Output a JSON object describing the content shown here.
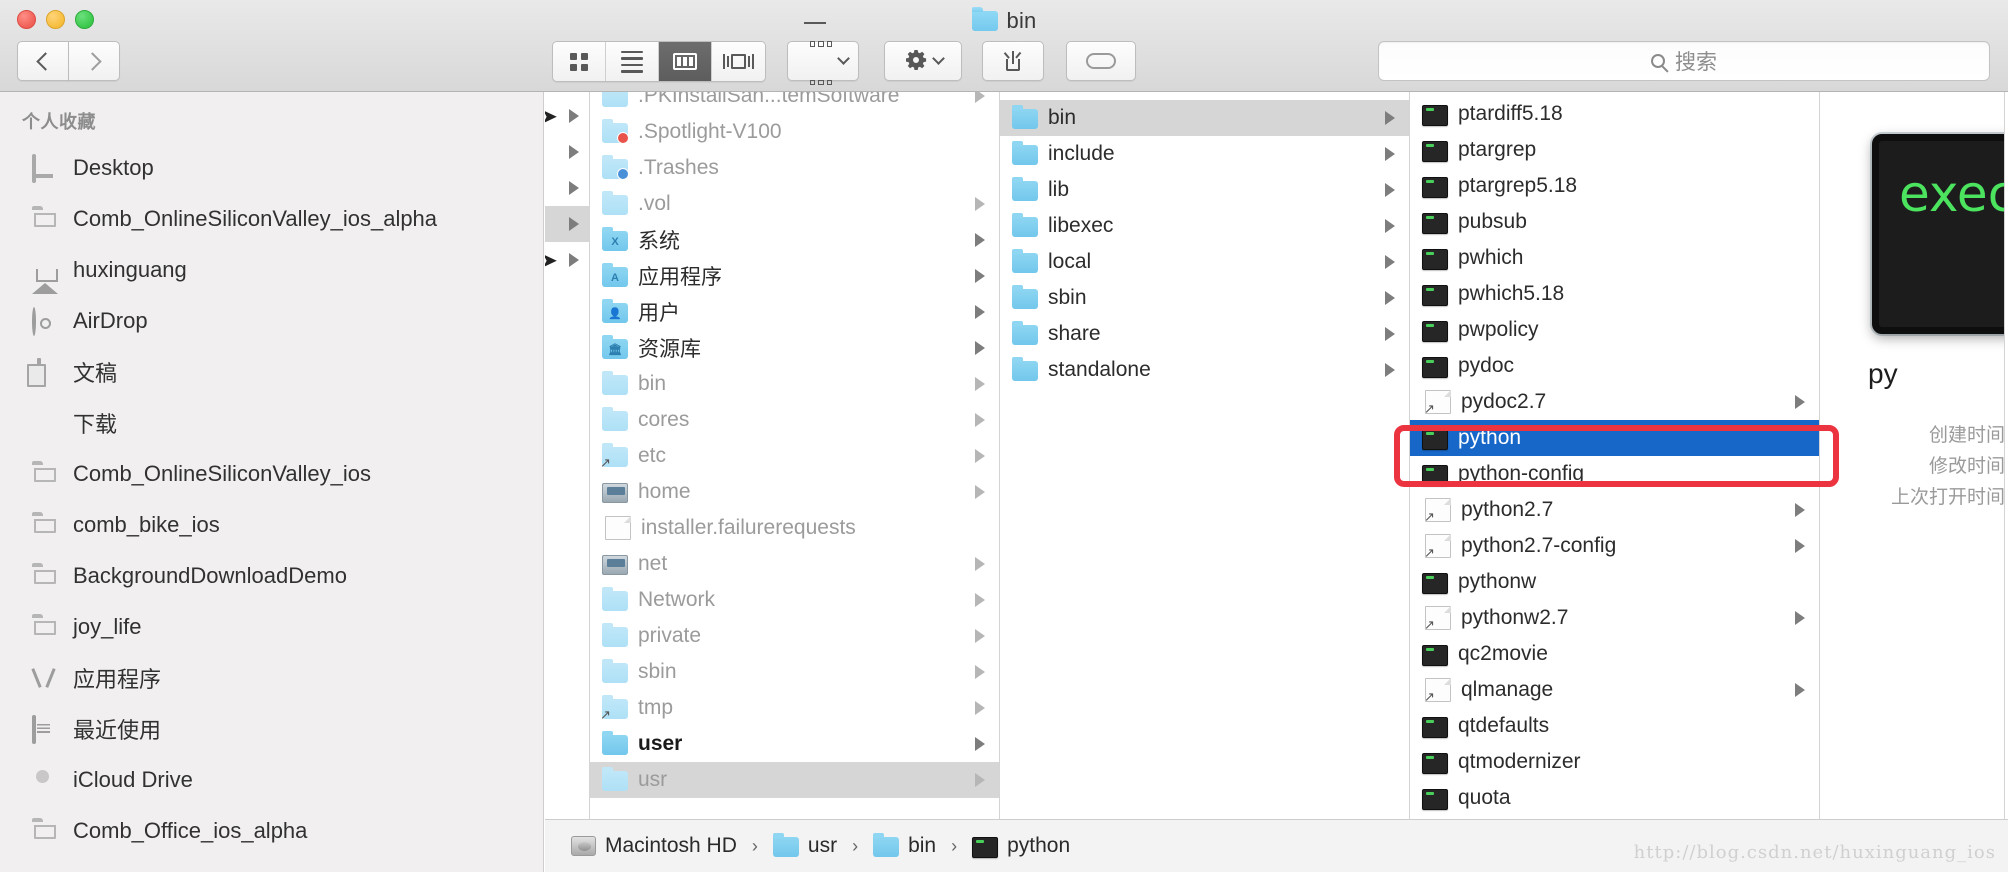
{
  "window": {
    "title": "bin",
    "title_icon": "blue-folder-icon",
    "traffic_lights": [
      "close-red",
      "minimize-yellow",
      "maximize-green"
    ]
  },
  "toolbar": {
    "back_label": "‹",
    "forward_label": "›",
    "view_buttons": [
      {
        "name": "icon-view",
        "active": false
      },
      {
        "name": "list-view",
        "active": false
      },
      {
        "name": "column-view",
        "active": true
      },
      {
        "name": "coverflow-view",
        "active": false
      }
    ],
    "arrange_button": "arrange-icon",
    "gear_button": "gear-icon",
    "share_button": "share-icon",
    "tag_button": "tag-icon"
  },
  "search": {
    "placeholder": "搜索",
    "value": "",
    "icon": "search-icon"
  },
  "sidebar": {
    "header": "个人收藏",
    "items": [
      {
        "label": "Desktop",
        "icon": "desktop-icon"
      },
      {
        "label": "Comb_OnlineSiliconValley_ios_alpha",
        "icon": "folder-icon"
      },
      {
        "label": "huxinguang",
        "icon": "home-icon"
      },
      {
        "label": "AirDrop",
        "icon": "airdrop-icon"
      },
      {
        "label": "文稿",
        "icon": "documents-icon"
      },
      {
        "label": "下载",
        "icon": "downloads-icon"
      },
      {
        "label": "Comb_OnlineSiliconValley_ios",
        "icon": "folder-icon"
      },
      {
        "label": "comb_bike_ios",
        "icon": "folder-icon"
      },
      {
        "label": "BackgroundDownloadDemo",
        "icon": "folder-icon"
      },
      {
        "label": "joy_life",
        "icon": "folder-icon"
      },
      {
        "label": "应用程序",
        "icon": "applications-icon"
      },
      {
        "label": "最近使用",
        "icon": "recents-icon"
      },
      {
        "label": "iCloud Drive",
        "icon": "icloud-icon"
      },
      {
        "label": "Comb_Office_ios_alpha",
        "icon": "folder-icon"
      }
    ]
  },
  "columns": [
    {
      "name": "column-root-partial",
      "rows": [
        {
          "label": "",
          "icon": "",
          "arrow": true,
          "state": "none",
          "cursor": true
        },
        {
          "label": "",
          "icon": "",
          "arrow": true,
          "state": "none"
        },
        {
          "label": "",
          "icon": "",
          "arrow": true,
          "state": "none"
        },
        {
          "label": "",
          "icon": "",
          "arrow": true,
          "state": "selected-gray"
        },
        {
          "label": "",
          "icon": "",
          "arrow": true,
          "state": "none",
          "cursor": true
        }
      ]
    },
    {
      "name": "column-macintosh-hd",
      "rows": [
        {
          "label": ".PKInstallSan...temSoftware",
          "icon": "folder-pale-icon",
          "arrow": true,
          "dim": true
        },
        {
          "label": ".Spotlight-V100",
          "icon": "folder-pale-stop-icon",
          "arrow": false,
          "dim": true
        },
        {
          "label": ".Trashes",
          "icon": "folder-pale-download-icon",
          "arrow": false,
          "dim": true
        },
        {
          "label": ".vol",
          "icon": "folder-pale-icon",
          "arrow": true,
          "dim": true
        },
        {
          "label": "系统",
          "icon": "folder-system-icon",
          "arrow": true,
          "dim": false
        },
        {
          "label": "应用程序",
          "icon": "folder-applications-icon",
          "arrow": true,
          "dim": false
        },
        {
          "label": "用户",
          "icon": "folder-users-icon",
          "arrow": true,
          "dim": false
        },
        {
          "label": "资源库",
          "icon": "folder-library-icon",
          "arrow": true,
          "dim": false
        },
        {
          "label": "bin",
          "icon": "folder-pale-icon",
          "arrow": true,
          "dim": true
        },
        {
          "label": "cores",
          "icon": "folder-pale-icon",
          "arrow": true,
          "dim": true
        },
        {
          "label": "etc",
          "icon": "folder-alias-icon",
          "arrow": true,
          "dim": true
        },
        {
          "label": "home",
          "icon": "network-drive-icon",
          "arrow": true,
          "dim": true
        },
        {
          "label": "installer.failurerequests",
          "icon": "document-icon",
          "arrow": false,
          "dim": true
        },
        {
          "label": "net",
          "icon": "network-drive-icon",
          "arrow": true,
          "dim": true
        },
        {
          "label": "Network",
          "icon": "folder-pale-icon",
          "arrow": true,
          "dim": true
        },
        {
          "label": "private",
          "icon": "folder-pale-icon",
          "arrow": true,
          "dim": true
        },
        {
          "label": "sbin",
          "icon": "folder-pale-icon",
          "arrow": true,
          "dim": true
        },
        {
          "label": "tmp",
          "icon": "folder-alias-icon",
          "arrow": true,
          "dim": true
        },
        {
          "label": "user",
          "icon": "folder-icon",
          "arrow": true,
          "dim": false,
          "bold": true
        },
        {
          "label": "usr",
          "icon": "folder-pale-icon",
          "arrow": true,
          "dim": true,
          "state": "selected-gray"
        }
      ]
    },
    {
      "name": "column-usr",
      "rows": [
        {
          "label": "bin",
          "icon": "folder-icon",
          "arrow": true,
          "state": "selected-gray"
        },
        {
          "label": "include",
          "icon": "folder-icon",
          "arrow": true
        },
        {
          "label": "lib",
          "icon": "folder-icon",
          "arrow": true
        },
        {
          "label": "libexec",
          "icon": "folder-icon",
          "arrow": true
        },
        {
          "label": "local",
          "icon": "folder-icon",
          "arrow": true
        },
        {
          "label": "sbin",
          "icon": "folder-icon",
          "arrow": true
        },
        {
          "label": "share",
          "icon": "folder-icon",
          "arrow": true
        },
        {
          "label": "standalone",
          "icon": "folder-icon",
          "arrow": true
        }
      ]
    },
    {
      "name": "column-usr-bin",
      "rows": [
        {
          "label": "ptardiff5.18",
          "icon": "exec-icon",
          "arrow": false
        },
        {
          "label": "ptargrep",
          "icon": "exec-icon",
          "arrow": false
        },
        {
          "label": "ptargrep5.18",
          "icon": "exec-icon",
          "arrow": false
        },
        {
          "label": "pubsub",
          "icon": "exec-icon",
          "arrow": false
        },
        {
          "label": "pwhich",
          "icon": "exec-icon",
          "arrow": false
        },
        {
          "label": "pwhich5.18",
          "icon": "exec-icon",
          "arrow": false
        },
        {
          "label": "pwpolicy",
          "icon": "exec-icon",
          "arrow": false
        },
        {
          "label": "pydoc",
          "icon": "exec-icon",
          "arrow": false
        },
        {
          "label": "pydoc2.7",
          "icon": "alias-doc-icon",
          "arrow": true
        },
        {
          "label": "python",
          "icon": "exec-icon",
          "arrow": false,
          "state": "selected-blue"
        },
        {
          "label": "python-config",
          "icon": "exec-icon",
          "arrow": false
        },
        {
          "label": "python2.7",
          "icon": "alias-doc-icon",
          "arrow": true
        },
        {
          "label": "python2.7-config",
          "icon": "alias-doc-icon",
          "arrow": true
        },
        {
          "label": "pythonw",
          "icon": "exec-icon",
          "arrow": false
        },
        {
          "label": "pythonw2.7",
          "icon": "alias-doc-icon",
          "arrow": true
        },
        {
          "label": "qc2movie",
          "icon": "exec-icon",
          "arrow": false
        },
        {
          "label": "qlmanage",
          "icon": "alias-doc-icon",
          "arrow": true
        },
        {
          "label": "qtdefaults",
          "icon": "exec-icon",
          "arrow": false
        },
        {
          "label": "qtmodernizer",
          "icon": "exec-icon",
          "arrow": false
        },
        {
          "label": "quota",
          "icon": "exec-icon",
          "arrow": false
        }
      ]
    }
  ],
  "preview": {
    "icon": "exec-icon-large",
    "icon_text": "exec",
    "name": "py",
    "meta_labels": [
      "创建时间",
      "修改时间",
      "上次打开时间"
    ]
  },
  "pathbar": {
    "crumbs": [
      {
        "label": "Macintosh HD",
        "icon": "harddisk-icon"
      },
      {
        "label": "usr",
        "icon": "folder-icon"
      },
      {
        "label": "bin",
        "icon": "folder-icon"
      },
      {
        "label": "python",
        "icon": "exec-icon"
      }
    ],
    "separator": "›"
  },
  "annotation": {
    "red_box_color": "#ec3440",
    "target": "python"
  },
  "watermark": "http://blog.csdn.net/huxinguang_ios",
  "colors": {
    "selection_blue": "#1767c9",
    "selection_gray": "#d6d6d6",
    "folder_blue": "#72c7ec",
    "annotation_red": "#ec3440"
  }
}
